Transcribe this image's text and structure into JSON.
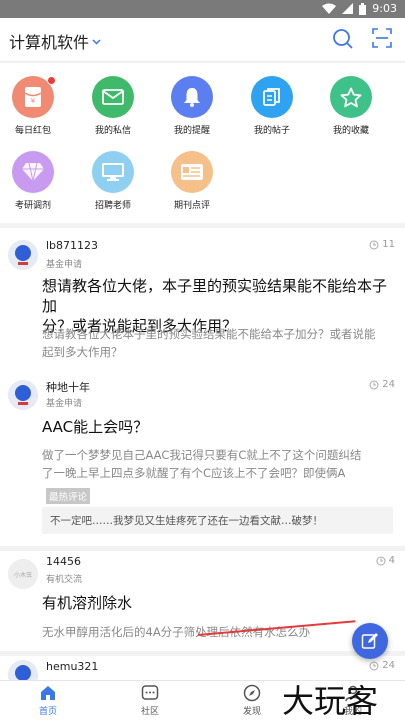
{
  "status_bar": {
    "time": "9:03"
  },
  "header": {
    "title": "计算机软件",
    "chevron": "chevron-down-icon"
  },
  "shortcuts": [
    {
      "label": "每日红包",
      "icon": "red-packet-icon",
      "color": "#f08a72",
      "badge": true
    },
    {
      "label": "我的私信",
      "icon": "mail-icon",
      "color": "#3fba6a",
      "badge": false
    },
    {
      "label": "我的提醒",
      "icon": "bell-icon",
      "color": "#5b7ef0",
      "badge": false
    },
    {
      "label": "我的帖子",
      "icon": "posts-icon",
      "color": "#2ea3f2",
      "badge": false
    },
    {
      "label": "我的收藏",
      "icon": "star-icon",
      "color": "#3fc28a",
      "badge": false
    },
    {
      "label": "考研调剂",
      "icon": "diamond-icon",
      "color": "#c89bf0",
      "badge": false
    },
    {
      "label": "招聘老师",
      "icon": "monitor-icon",
      "color": "#8fd0f0",
      "badge": false
    },
    {
      "label": "期刊点评",
      "icon": "card-icon",
      "color": "#f5c08a",
      "badge": false
    }
  ],
  "posts": [
    {
      "user": "lb871123",
      "section": "基金申请",
      "count": "11",
      "title_lines": [
        "想请教各位大佬，本子里的预实验结果能不能给本子加",
        "分？或者说能起到多大作用？"
      ],
      "excerpt_lines": [
        "想请教各位大佬本子里的预实验结果能不能给本子加分？或者说能",
        "起到多大作用？"
      ]
    },
    {
      "user": "种地十年",
      "section": "基金申请",
      "count": "24",
      "title_lines": [
        "AAC能上会吗？"
      ],
      "excerpt_lines": [
        "做了一个梦梦见自己AAC我记得只要有C就上不了这个问题纠结",
        "了一晚上早上四点多就醒了有个C应该上不了会吧？即使俩A"
      ],
      "hot_tag": "最热评论",
      "hot_comment": "不一定吧……我梦见又生娃疼死了还在一边看文献…破梦！"
    },
    {
      "user": "14456",
      "section": "有机交流",
      "count": "4",
      "title_lines": [
        "有机溶剂除水"
      ],
      "excerpt_lines": [
        "无水甲醇用活化后的4A分子筛处理后依然有水怎么办"
      ]
    },
    {
      "user": "hemu321",
      "section": "",
      "count": "24",
      "title_lines": [],
      "excerpt_lines": []
    }
  ],
  "tabs": [
    {
      "label": "首页",
      "icon": "home-icon",
      "active": true
    },
    {
      "label": "社区",
      "icon": "community-icon",
      "active": false
    },
    {
      "label": "发现",
      "icon": "compass-icon",
      "active": false
    },
    {
      "label": "我的",
      "icon": "profile-icon",
      "active": false
    }
  ],
  "watermark": "大玩客",
  "colors": {
    "accent": "#3b78e7",
    "fab": "#3f67e0",
    "annotation": "#e23b3b"
  }
}
